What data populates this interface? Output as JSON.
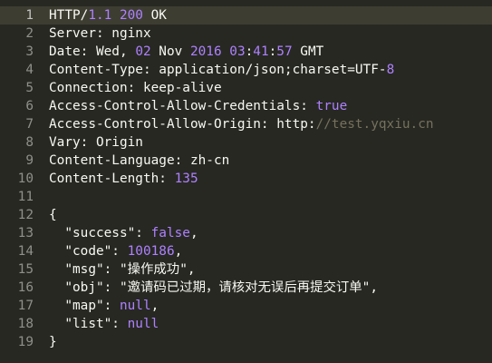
{
  "editor": {
    "current_line": 1,
    "lines": [
      {
        "n": "1",
        "segments": [
          {
            "t": "HTTP/",
            "c": ""
          },
          {
            "t": "1.1 200",
            "c": "num"
          },
          {
            "t": " OK",
            "c": ""
          }
        ]
      },
      {
        "n": "2",
        "segments": [
          {
            "t": "Server: nginx",
            "c": ""
          }
        ]
      },
      {
        "n": "3",
        "segments": [
          {
            "t": "Date: Wed, ",
            "c": ""
          },
          {
            "t": "02",
            "c": "num"
          },
          {
            "t": " Nov ",
            "c": ""
          },
          {
            "t": "2016 03",
            "c": "num"
          },
          {
            "t": ":",
            "c": ""
          },
          {
            "t": "41",
            "c": "num"
          },
          {
            "t": ":",
            "c": ""
          },
          {
            "t": "57",
            "c": "num"
          },
          {
            "t": " GMT",
            "c": ""
          }
        ]
      },
      {
        "n": "4",
        "segments": [
          {
            "t": "Content-Type: application/json;charset=UTF-",
            "c": ""
          },
          {
            "t": "8",
            "c": "num"
          }
        ]
      },
      {
        "n": "5",
        "segments": [
          {
            "t": "Connection: keep-alive",
            "c": ""
          }
        ]
      },
      {
        "n": "6",
        "segments": [
          {
            "t": "Access-Control-Allow-Credentials: ",
            "c": ""
          },
          {
            "t": "true",
            "c": "kw"
          }
        ]
      },
      {
        "n": "7",
        "segments": [
          {
            "t": "Access-Control-Allow-Origin: http:",
            "c": ""
          },
          {
            "t": "//test.yqxiu.cn",
            "c": "dim"
          }
        ]
      },
      {
        "n": "8",
        "segments": [
          {
            "t": "Vary: Origin",
            "c": ""
          }
        ]
      },
      {
        "n": "9",
        "segments": [
          {
            "t": "Content-Language: zh-cn",
            "c": ""
          }
        ]
      },
      {
        "n": "10",
        "segments": [
          {
            "t": "Content-Length: ",
            "c": ""
          },
          {
            "t": "135",
            "c": "num"
          }
        ]
      },
      {
        "n": "11",
        "segments": []
      },
      {
        "n": "12",
        "segments": [
          {
            "t": "{",
            "c": ""
          }
        ]
      },
      {
        "n": "13",
        "segments": [
          {
            "t": "  \"success\": ",
            "c": ""
          },
          {
            "t": "false",
            "c": "kw"
          },
          {
            "t": ",",
            "c": ""
          }
        ]
      },
      {
        "n": "14",
        "segments": [
          {
            "t": "  \"code\": ",
            "c": ""
          },
          {
            "t": "100186",
            "c": "num"
          },
          {
            "t": ",",
            "c": ""
          }
        ]
      },
      {
        "n": "15",
        "segments": [
          {
            "t": "  \"msg\": \"操作成功\",",
            "c": ""
          }
        ]
      },
      {
        "n": "16",
        "segments": [
          {
            "t": "  \"obj\": \"邀请码已过期，请核对无误后再提交订单\",",
            "c": ""
          }
        ]
      },
      {
        "n": "17",
        "segments": [
          {
            "t": "  \"map\": ",
            "c": ""
          },
          {
            "t": "null",
            "c": "kw"
          },
          {
            "t": ",",
            "c": ""
          }
        ]
      },
      {
        "n": "18",
        "segments": [
          {
            "t": "  \"list\": ",
            "c": ""
          },
          {
            "t": "null",
            "c": "kw"
          }
        ]
      },
      {
        "n": "19",
        "segments": [
          {
            "t": "}",
            "c": ""
          }
        ]
      }
    ]
  },
  "colors": {
    "background": "#272822",
    "current_line": "#3e3d32",
    "foreground": "#f8f8f2",
    "number": "#ae81ff",
    "comment": "#75715e",
    "gutter": "#90908a"
  }
}
